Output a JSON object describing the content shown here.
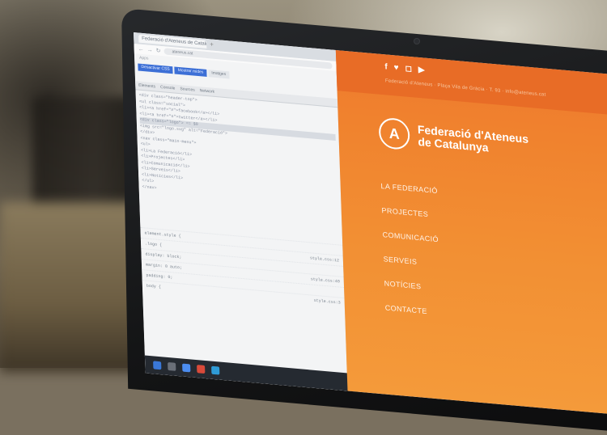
{
  "browser": {
    "tab_title": "Federació d'Ateneus de Catalunya",
    "new_tab_icon": "plus-icon",
    "url": "ateneus.cat",
    "bookmarks_label": "Apps",
    "toolbar": [
      {
        "label": "Desactivar CSS",
        "style": "blue"
      },
      {
        "label": "Mostrar mides",
        "style": "blue"
      },
      {
        "label": "Imatges",
        "style": "plain"
      }
    ],
    "devtools_tabs": [
      "Elements",
      "Console",
      "Sources",
      "Network"
    ],
    "code_lines": [
      "<div class=\"header-top\">",
      "  <ul class=\"social\">",
      "    <li><a href=\"#\">facebook</a></li>",
      "    <li><a href=\"#\">twitter</a></li>",
      "<div class=\"logo\"> == $0",
      "  <img src=\"logo.svg\" alt=\"Federació\">",
      "</div>",
      "<nav class=\"main-menu\">",
      "  <ul>",
      "    <li>La Federació</li>",
      "    <li>Projectes</li>",
      "    <li>Comunicació</li>",
      "    <li>Serveis</li>",
      "    <li>Notícies</li>",
      "  </ul>",
      "</nav>"
    ],
    "rules": [
      {
        "left": "element.style {",
        "right": ""
      },
      {
        "left": ".logo {",
        "right": "style.css:12"
      },
      {
        "left": "display: block;",
        "right": ""
      },
      {
        "left": "margin: 0 auto;",
        "right": "style.css:40"
      },
      {
        "left": "padding: 0;",
        "right": ""
      },
      {
        "left": "body {",
        "right": "style.css:3"
      }
    ]
  },
  "site": {
    "social_icons": [
      "f",
      "♥",
      "◻",
      "▶"
    ],
    "top_line": "Federació d'Ateneus · Plaça Vila de Gràcia · T. 93 · info@ateneus.cat",
    "logo_letter": "A",
    "logo_line1": "Federació d'Ateneus",
    "logo_line2": "de Catalunya",
    "menu": [
      "LA FEDERACIÓ",
      "PROJECTES",
      "COMUNICACIÓ",
      "SERVEIS",
      "NOTÍCIES",
      "CONTACTE"
    ]
  },
  "colors": {
    "site_orange": "#f0822e",
    "site_header": "#e86c26",
    "devtools_blue": "#3c6fd6",
    "bezel": "#141516"
  }
}
